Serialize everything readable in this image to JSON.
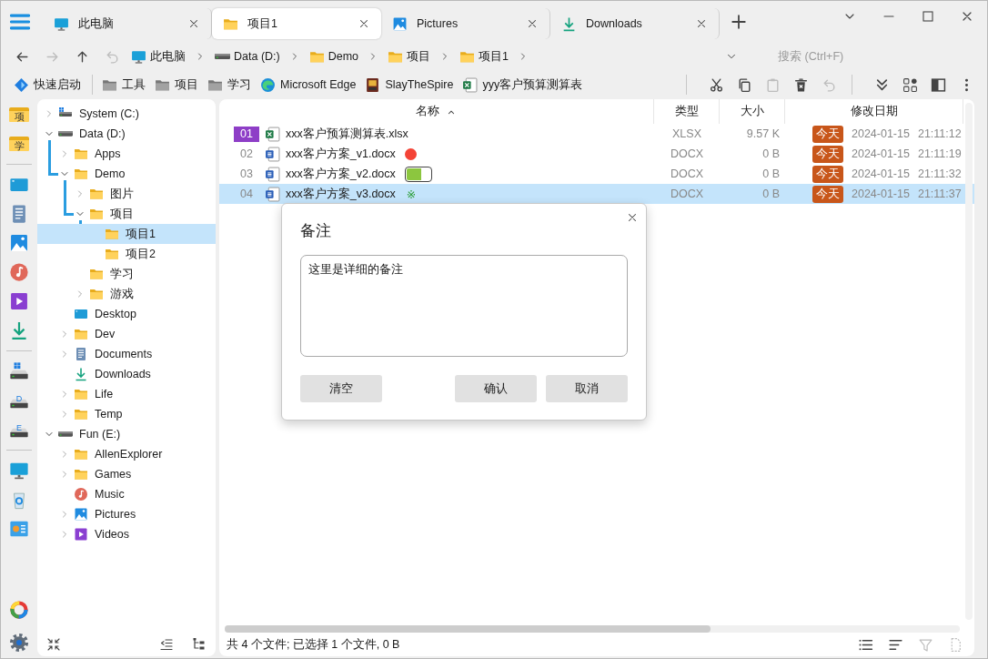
{
  "tabs": [
    {
      "label": "此电脑",
      "kind": "monitor",
      "selected": false
    },
    {
      "label": "项目1",
      "kind": "folder",
      "selected": true
    },
    {
      "label": "Pictures",
      "kind": "pictures",
      "selected": false
    },
    {
      "label": "Downloads",
      "kind": "downloads",
      "selected": false
    }
  ],
  "nav_buttons": [
    {
      "kind": "back",
      "disabled": false
    },
    {
      "kind": "forward",
      "disabled": true
    },
    {
      "kind": "up",
      "disabled": false
    },
    {
      "kind": "undo",
      "disabled": true
    }
  ],
  "breadcrumbs": [
    {
      "label": "此电脑",
      "kind": "monitor"
    },
    {
      "label": "Data (D:)",
      "kind": "drive"
    },
    {
      "label": "Demo",
      "kind": "folder"
    },
    {
      "label": "项目",
      "kind": "folder"
    },
    {
      "label": "项目1",
      "kind": "folder"
    }
  ],
  "search": {
    "placeholder": "搜索 (Ctrl+F)"
  },
  "bookmarks": [
    {
      "label": "快速启动",
      "kind": "quick"
    },
    {
      "label": "工具",
      "kind": "folder-grey"
    },
    {
      "label": "项目",
      "kind": "folder-grey"
    },
    {
      "label": "学习",
      "kind": "folder-grey"
    },
    {
      "label": "Microsoft Edge",
      "kind": "edge"
    },
    {
      "label": "SlayTheSpire",
      "kind": "game"
    },
    {
      "label": "yyy客户预算测算表",
      "kind": "excel"
    }
  ],
  "toolbar": [
    [
      {
        "kind": "cut",
        "disabled": false
      },
      {
        "kind": "copy",
        "disabled": false
      },
      {
        "kind": "paste",
        "disabled": true
      },
      {
        "kind": "delete",
        "disabled": false
      },
      {
        "kind": "undo",
        "disabled": true
      }
    ],
    [
      {
        "kind": "expand",
        "disabled": false
      },
      {
        "kind": "grid",
        "disabled": false
      },
      {
        "kind": "panel",
        "disabled": false
      },
      {
        "kind": "more",
        "disabled": false
      }
    ]
  ],
  "rail": {
    "groups": [
      [
        {
          "kind": "folder",
          "label": "项"
        },
        {
          "kind": "folder",
          "label": "学"
        }
      ],
      [
        {
          "kind": "desktop"
        },
        {
          "kind": "documents"
        },
        {
          "kind": "pictures"
        },
        {
          "kind": "music"
        },
        {
          "kind": "videos"
        },
        {
          "kind": "downloads"
        }
      ],
      [
        {
          "kind": "drive-win"
        },
        {
          "kind": "drive",
          "label": "D"
        },
        {
          "kind": "drive",
          "label": "E"
        }
      ],
      [
        {
          "kind": "monitor"
        },
        {
          "kind": "recycle"
        },
        {
          "kind": "control"
        }
      ]
    ],
    "bottom": [
      {
        "kind": "colorwheel"
      },
      {
        "kind": "gear"
      }
    ]
  },
  "tree": [
    {
      "label": "System (C:)",
      "kind": "drive-win",
      "expandable": true,
      "expanded": false,
      "selected": false
    },
    {
      "label": "Data (D:)",
      "kind": "drive",
      "expandable": true,
      "expanded": true,
      "selected": false,
      "children": [
        {
          "label": "Apps",
          "kind": "folder",
          "expandable": true,
          "expanded": false,
          "selected": false
        },
        {
          "label": "Demo",
          "kind": "folder",
          "expandable": true,
          "expanded": true,
          "selected": false,
          "children": [
            {
              "label": "图片",
              "kind": "folder",
              "expandable": true,
              "expanded": false,
              "selected": false
            },
            {
              "label": "项目",
              "kind": "folder",
              "expandable": true,
              "expanded": true,
              "selected": false,
              "children": [
                {
                  "label": "项目1",
                  "kind": "folder",
                  "expandable": false,
                  "selected": true
                },
                {
                  "label": "项目2",
                  "kind": "folder",
                  "expandable": false,
                  "selected": false
                }
              ]
            },
            {
              "label": "学习",
              "kind": "folder",
              "expandable": false,
              "selected": false
            },
            {
              "label": "游戏",
              "kind": "folder",
              "expandable": true,
              "expanded": false,
              "selected": false
            }
          ]
        },
        {
          "label": "Desktop",
          "kind": "desktop",
          "expandable": false,
          "selected": false
        },
        {
          "label": "Dev",
          "kind": "folder",
          "expandable": true,
          "expanded": false,
          "selected": false
        },
        {
          "label": "Documents",
          "kind": "documents",
          "expandable": true,
          "expanded": false,
          "selected": false
        },
        {
          "label": "Downloads",
          "kind": "downloads",
          "expandable": false,
          "selected": false
        },
        {
          "label": "Life",
          "kind": "folder",
          "expandable": true,
          "expanded": false,
          "selected": false
        },
        {
          "label": "Temp",
          "kind": "folder",
          "expandable": true,
          "expanded": false,
          "selected": false
        }
      ]
    },
    {
      "label": "Fun (E:)",
      "kind": "drive",
      "expandable": true,
      "expanded": true,
      "selected": false,
      "children": [
        {
          "label": "AllenExplorer",
          "kind": "folder",
          "expandable": true,
          "expanded": false,
          "selected": false
        },
        {
          "label": "Games",
          "kind": "folder",
          "expandable": true,
          "expanded": false,
          "selected": false
        },
        {
          "label": "Music",
          "kind": "music",
          "expandable": false,
          "selected": false
        },
        {
          "label": "Pictures",
          "kind": "pictures",
          "expandable": true,
          "expanded": false,
          "selected": false
        },
        {
          "label": "Videos",
          "kind": "videos",
          "expandable": true,
          "expanded": false,
          "selected": false
        }
      ]
    }
  ],
  "tree_tools": [
    {
      "kind": "collapse"
    },
    {
      "kind": "outdent"
    },
    {
      "kind": "treeview"
    }
  ],
  "files": {
    "columns": [
      {
        "label": "名称",
        "sorted": true
      },
      {
        "label": "类型",
        "sorted": false
      },
      {
        "label": "大小",
        "sorted": false
      },
      {
        "label": "修改日期",
        "sorted": false
      }
    ],
    "rows": [
      {
        "index": "01",
        "index_marked": true,
        "kind": "excel",
        "name": "xxx客户预算测算表.xlsx",
        "type": "XLSX",
        "size": "9.57 K",
        "badge": "今天",
        "date": "2024-01-15",
        "time": "21:11:12",
        "selected": false
      },
      {
        "index": "02",
        "index_marked": false,
        "kind": "word",
        "name": "xxx客户方案_v1.docx",
        "tag": {
          "kind": "dot",
          "color": "#f44336"
        },
        "type": "DOCX",
        "size": "0 B",
        "badge": "今天",
        "date": "2024-01-15",
        "time": "21:11:19",
        "selected": false
      },
      {
        "index": "03",
        "index_marked": false,
        "kind": "word",
        "name": "xxx客户方案_v2.docx",
        "tag": {
          "kind": "toggle",
          "on": true
        },
        "type": "DOCX",
        "size": "0 B",
        "badge": "今天",
        "date": "2024-01-15",
        "time": "21:11:32",
        "selected": false
      },
      {
        "index": "04",
        "index_marked": false,
        "kind": "word",
        "name": "xxx客户方案_v3.docx",
        "tag": {
          "kind": "symbol",
          "text": "※",
          "color": "#2e9e3a"
        },
        "type": "DOCX",
        "size": "0 B",
        "badge": "今天",
        "date": "2024-01-15",
        "time": "21:11:37",
        "selected": true
      }
    ]
  },
  "dialog": {
    "title": "备注",
    "note": "这里是详细的备注",
    "buttons": [
      {
        "label": "清空"
      },
      {
        "label": "确认"
      },
      {
        "label": "取消"
      }
    ]
  },
  "status": {
    "text": "共 4 个文件; 已选择 1 个文件, 0 B",
    "tools": [
      {
        "kind": "list",
        "disabled": false
      },
      {
        "kind": "sort",
        "disabled": false
      },
      {
        "kind": "filter",
        "disabled": true
      },
      {
        "kind": "file",
        "disabled": true
      }
    ]
  }
}
